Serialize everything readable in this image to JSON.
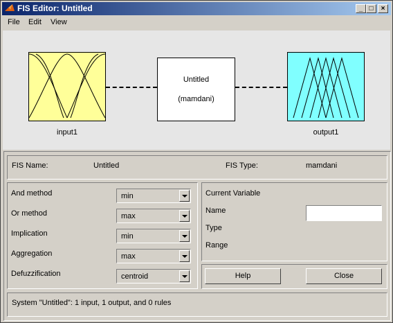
{
  "title": "FIS Editor: Untitled",
  "window_buttons": {
    "minimize": "_",
    "maximize": "□",
    "close": "×"
  },
  "menu": [
    {
      "label": "File"
    },
    {
      "label": "Edit"
    },
    {
      "label": "View"
    }
  ],
  "diagram": {
    "input_label": "input1",
    "output_label": "output1",
    "system_name": "Untitled",
    "system_type": "(mamdani)",
    "input_color": "#ffff99",
    "output_color": "#80ffff"
  },
  "fis_info": {
    "name_label": "FIS Name:",
    "name_value": "Untitled",
    "type_label": "FIS Type:",
    "type_value": "mamdani"
  },
  "methods": [
    {
      "label": "And method",
      "value": "min"
    },
    {
      "label": "Or method",
      "value": "max"
    },
    {
      "label": "Implication",
      "value": "min"
    },
    {
      "label": "Aggregation",
      "value": "max"
    },
    {
      "label": "Defuzzification",
      "value": "centroid"
    }
  ],
  "current_variable": {
    "title": "Current Variable",
    "name_label": "Name",
    "type_label": "Type",
    "range_label": "Range",
    "name_value": ""
  },
  "buttons": {
    "help": "Help",
    "close": "Close"
  },
  "status": "System \"Untitled\": 1 input, 1 output, and 0 rules"
}
